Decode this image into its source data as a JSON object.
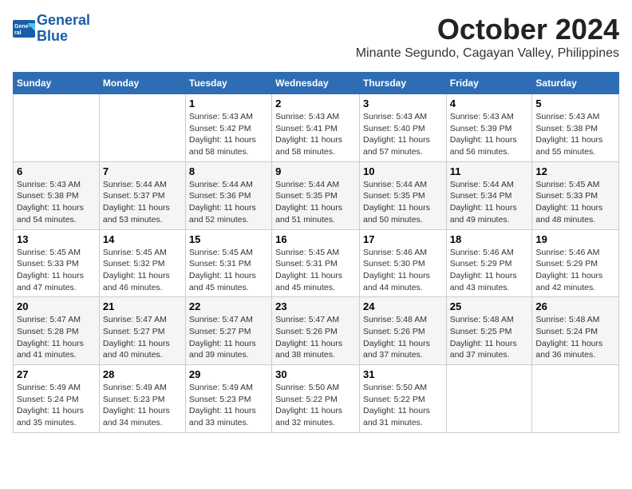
{
  "header": {
    "logo_line1": "General",
    "logo_line2": "Blue",
    "title": "October 2024",
    "subtitle": "Minante Segundo, Cagayan Valley, Philippines"
  },
  "days_of_week": [
    "Sunday",
    "Monday",
    "Tuesday",
    "Wednesday",
    "Thursday",
    "Friday",
    "Saturday"
  ],
  "weeks": [
    [
      {
        "day": "",
        "info": ""
      },
      {
        "day": "",
        "info": ""
      },
      {
        "day": "1",
        "info": "Sunrise: 5:43 AM\nSunset: 5:42 PM\nDaylight: 11 hours and 58 minutes."
      },
      {
        "day": "2",
        "info": "Sunrise: 5:43 AM\nSunset: 5:41 PM\nDaylight: 11 hours and 58 minutes."
      },
      {
        "day": "3",
        "info": "Sunrise: 5:43 AM\nSunset: 5:40 PM\nDaylight: 11 hours and 57 minutes."
      },
      {
        "day": "4",
        "info": "Sunrise: 5:43 AM\nSunset: 5:39 PM\nDaylight: 11 hours and 56 minutes."
      },
      {
        "day": "5",
        "info": "Sunrise: 5:43 AM\nSunset: 5:38 PM\nDaylight: 11 hours and 55 minutes."
      }
    ],
    [
      {
        "day": "6",
        "info": "Sunrise: 5:43 AM\nSunset: 5:38 PM\nDaylight: 11 hours and 54 minutes."
      },
      {
        "day": "7",
        "info": "Sunrise: 5:44 AM\nSunset: 5:37 PM\nDaylight: 11 hours and 53 minutes."
      },
      {
        "day": "8",
        "info": "Sunrise: 5:44 AM\nSunset: 5:36 PM\nDaylight: 11 hours and 52 minutes."
      },
      {
        "day": "9",
        "info": "Sunrise: 5:44 AM\nSunset: 5:35 PM\nDaylight: 11 hours and 51 minutes."
      },
      {
        "day": "10",
        "info": "Sunrise: 5:44 AM\nSunset: 5:35 PM\nDaylight: 11 hours and 50 minutes."
      },
      {
        "day": "11",
        "info": "Sunrise: 5:44 AM\nSunset: 5:34 PM\nDaylight: 11 hours and 49 minutes."
      },
      {
        "day": "12",
        "info": "Sunrise: 5:45 AM\nSunset: 5:33 PM\nDaylight: 11 hours and 48 minutes."
      }
    ],
    [
      {
        "day": "13",
        "info": "Sunrise: 5:45 AM\nSunset: 5:33 PM\nDaylight: 11 hours and 47 minutes."
      },
      {
        "day": "14",
        "info": "Sunrise: 5:45 AM\nSunset: 5:32 PM\nDaylight: 11 hours and 46 minutes."
      },
      {
        "day": "15",
        "info": "Sunrise: 5:45 AM\nSunset: 5:31 PM\nDaylight: 11 hours and 45 minutes."
      },
      {
        "day": "16",
        "info": "Sunrise: 5:45 AM\nSunset: 5:31 PM\nDaylight: 11 hours and 45 minutes."
      },
      {
        "day": "17",
        "info": "Sunrise: 5:46 AM\nSunset: 5:30 PM\nDaylight: 11 hours and 44 minutes."
      },
      {
        "day": "18",
        "info": "Sunrise: 5:46 AM\nSunset: 5:29 PM\nDaylight: 11 hours and 43 minutes."
      },
      {
        "day": "19",
        "info": "Sunrise: 5:46 AM\nSunset: 5:29 PM\nDaylight: 11 hours and 42 minutes."
      }
    ],
    [
      {
        "day": "20",
        "info": "Sunrise: 5:47 AM\nSunset: 5:28 PM\nDaylight: 11 hours and 41 minutes."
      },
      {
        "day": "21",
        "info": "Sunrise: 5:47 AM\nSunset: 5:27 PM\nDaylight: 11 hours and 40 minutes."
      },
      {
        "day": "22",
        "info": "Sunrise: 5:47 AM\nSunset: 5:27 PM\nDaylight: 11 hours and 39 minutes."
      },
      {
        "day": "23",
        "info": "Sunrise: 5:47 AM\nSunset: 5:26 PM\nDaylight: 11 hours and 38 minutes."
      },
      {
        "day": "24",
        "info": "Sunrise: 5:48 AM\nSunset: 5:26 PM\nDaylight: 11 hours and 37 minutes."
      },
      {
        "day": "25",
        "info": "Sunrise: 5:48 AM\nSunset: 5:25 PM\nDaylight: 11 hours and 37 minutes."
      },
      {
        "day": "26",
        "info": "Sunrise: 5:48 AM\nSunset: 5:24 PM\nDaylight: 11 hours and 36 minutes."
      }
    ],
    [
      {
        "day": "27",
        "info": "Sunrise: 5:49 AM\nSunset: 5:24 PM\nDaylight: 11 hours and 35 minutes."
      },
      {
        "day": "28",
        "info": "Sunrise: 5:49 AM\nSunset: 5:23 PM\nDaylight: 11 hours and 34 minutes."
      },
      {
        "day": "29",
        "info": "Sunrise: 5:49 AM\nSunset: 5:23 PM\nDaylight: 11 hours and 33 minutes."
      },
      {
        "day": "30",
        "info": "Sunrise: 5:50 AM\nSunset: 5:22 PM\nDaylight: 11 hours and 32 minutes."
      },
      {
        "day": "31",
        "info": "Sunrise: 5:50 AM\nSunset: 5:22 PM\nDaylight: 11 hours and 31 minutes."
      },
      {
        "day": "",
        "info": ""
      },
      {
        "day": "",
        "info": ""
      }
    ]
  ]
}
